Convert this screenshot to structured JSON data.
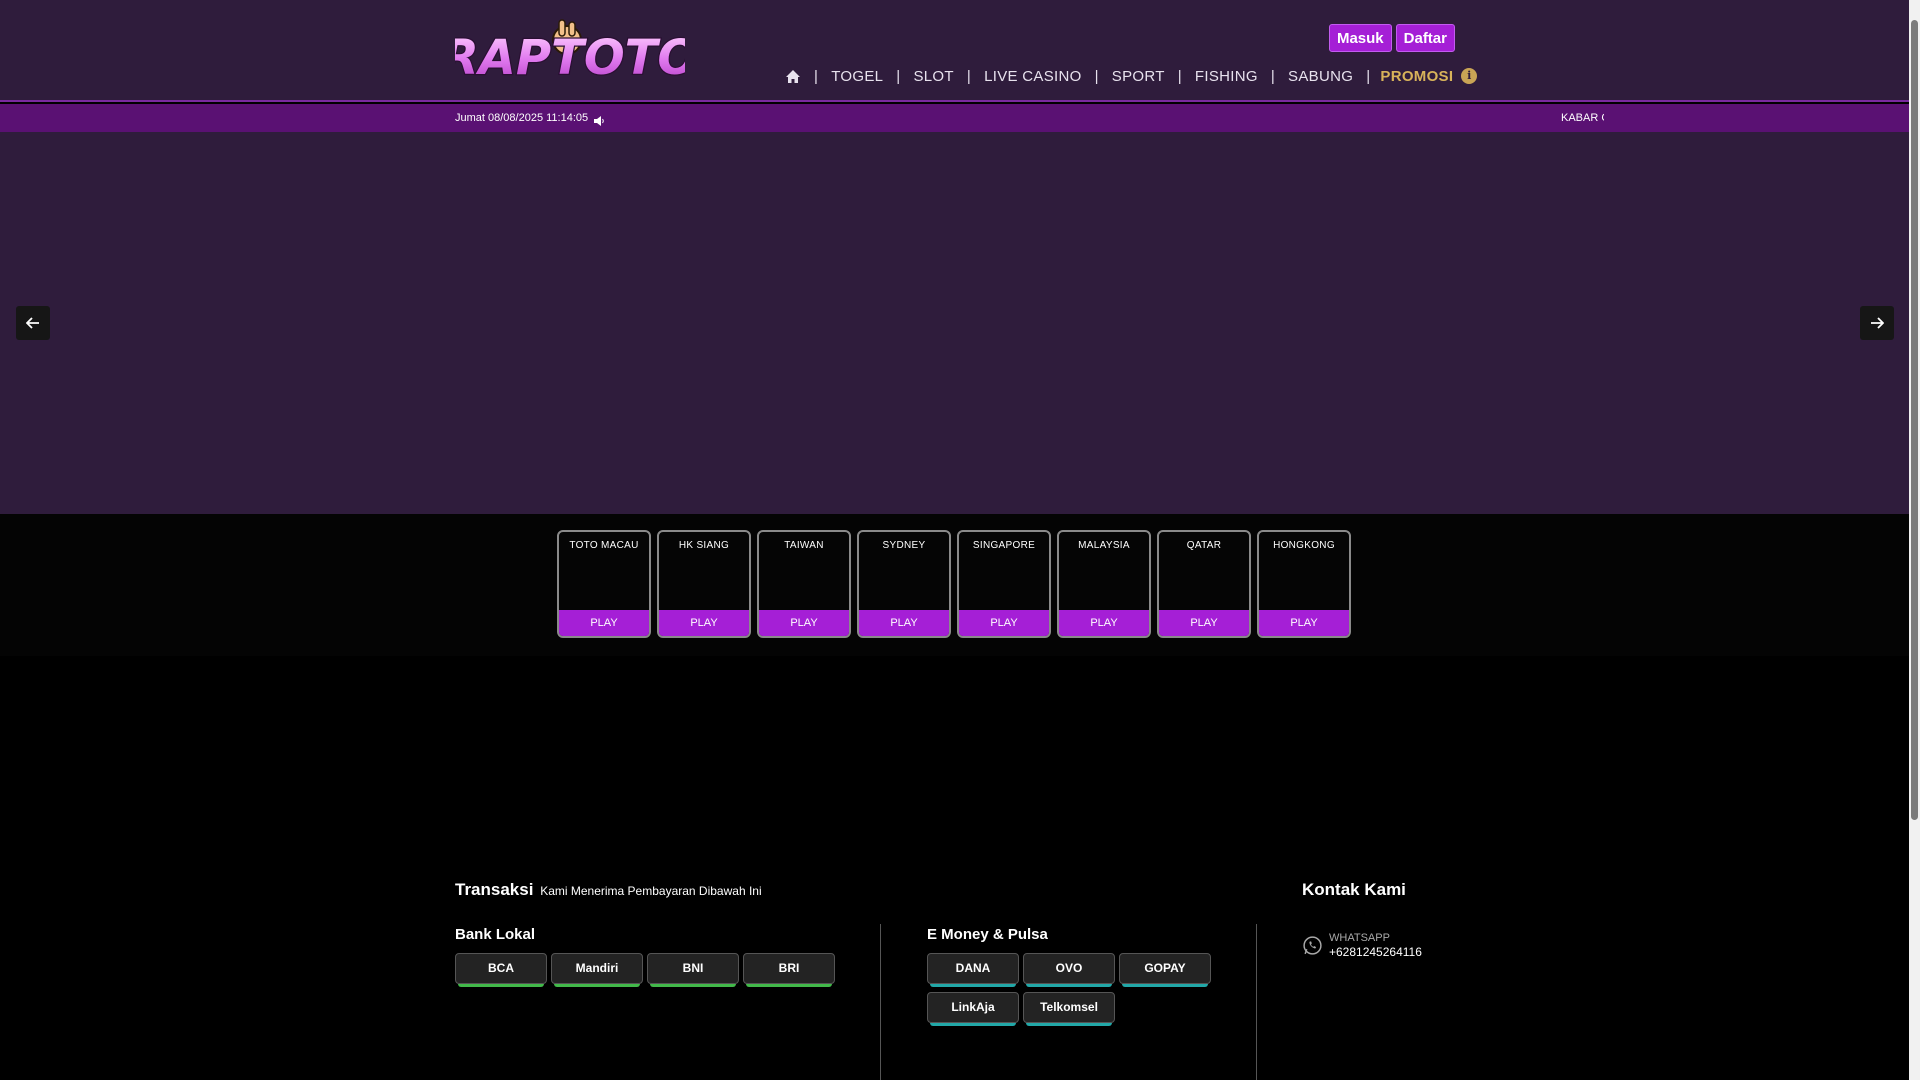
{
  "header": {
    "logo_text": "RAPTOTO",
    "login_label": "Masuk",
    "register_label": "Daftar",
    "nav": [
      "TOGEL",
      "SLOT",
      "LIVE CASINO",
      "SPORT",
      "FISHING",
      "SABUNG"
    ],
    "promo_label": "PROMOSI",
    "info_glyph": "i",
    "separator": "|"
  },
  "ticker": {
    "datetime": "Jumat 08/08/2025 11:14:05",
    "marquee": "KABAR GEMBIRA"
  },
  "games": [
    {
      "name": "TOTO MACAU",
      "play": "PLAY"
    },
    {
      "name": "HK SIANG",
      "play": "PLAY"
    },
    {
      "name": "TAIWAN",
      "play": "PLAY"
    },
    {
      "name": "SYDNEY",
      "play": "PLAY"
    },
    {
      "name": "SINGAPORE",
      "play": "PLAY"
    },
    {
      "name": "MALAYSIA",
      "play": "PLAY"
    },
    {
      "name": "QATAR",
      "play": "PLAY"
    },
    {
      "name": "HONGKONG",
      "play": "PLAY"
    }
  ],
  "footer": {
    "transaksi_title": "Transaksi",
    "transaksi_sub": "Kami Menerima Pembayaran Dibawah Ini",
    "bank_title": "Bank Lokal",
    "banks": [
      "BCA",
      "Mandiri",
      "BNI",
      "BRI"
    ],
    "emoney_title": "E Money & Pulsa",
    "emoney": [
      "DANA",
      "OVO",
      "GOPAY",
      "LinkAja",
      "Telkomsel"
    ],
    "contact_title": "Kontak Kami",
    "whatsapp_label": "WHATSAPP",
    "whatsapp_number": "+6281245264116"
  },
  "colors": {
    "header_bg": "#2f1c3c",
    "accent_purple": "#a51fd6",
    "ticker_bg": "#5a1173",
    "promo_gold": "#d8b35a",
    "bank_green": "#42b94a",
    "emoney_teal": "#22a8a8"
  },
  "icons": {
    "home": "home-icon",
    "speaker": "speaker-icon",
    "arrow_left": "arrow-left-icon",
    "arrow_right": "arrow-right-icon",
    "whatsapp": "whatsapp-icon",
    "info": "info-icon"
  }
}
